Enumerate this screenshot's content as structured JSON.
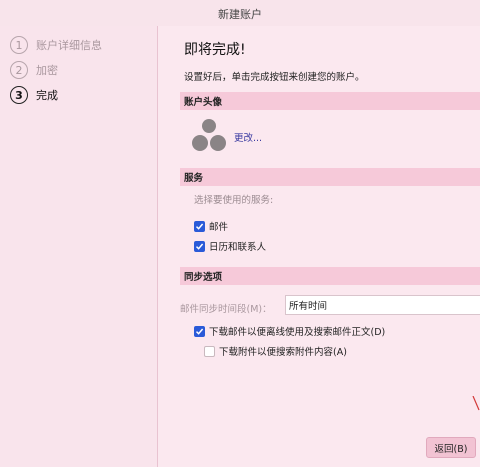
{
  "window": {
    "title": "新建账户"
  },
  "steps": [
    {
      "num": "1",
      "label": "账户详细信息",
      "active": false
    },
    {
      "num": "2",
      "label": "加密",
      "active": false
    },
    {
      "num": "3",
      "label": "完成",
      "active": true
    }
  ],
  "main": {
    "heading": "即将完成!",
    "description": "设置好后，单击完成按钮来创建您的账户。",
    "avatar_section": {
      "title": "账户头像",
      "change_link": "更改..."
    },
    "services_section": {
      "title": "服务",
      "hint": "选择要使用的服务:",
      "items": [
        {
          "label": "邮件",
          "checked": true
        },
        {
          "label": "日历和联系人",
          "checked": true
        }
      ]
    },
    "sync_section": {
      "title": "同步选项",
      "period_label": "邮件同步时间段(M)：",
      "period_value": "所有时间",
      "offline_label": "下载邮件以便离线使用及搜索邮件正文(D)",
      "offline_checked": true,
      "attachments_label": "下载附件以便搜索附件内容(A)",
      "attachments_checked": false
    }
  },
  "footer": {
    "back_label": "返回(B)"
  },
  "colors": {
    "accent": "#2a5ad8",
    "section_bg": "#f6c9d9",
    "button_bg": "#f2c3d3"
  }
}
